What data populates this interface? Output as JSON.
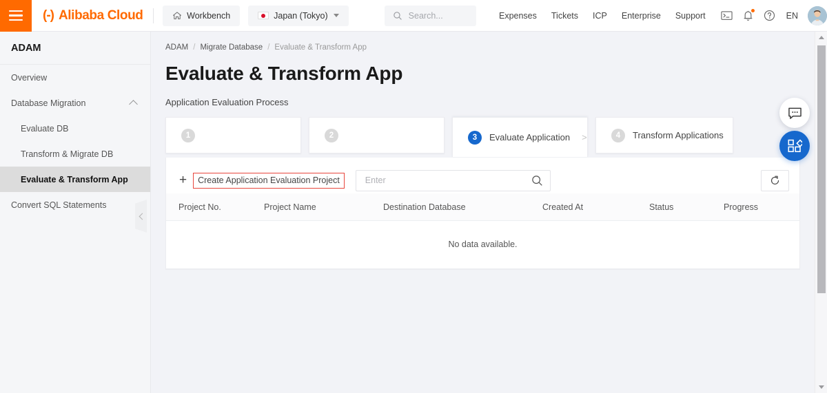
{
  "header": {
    "menu_icon": "hamburger-icon",
    "brand_mark": "(-)",
    "brand_text": "Alibaba Cloud",
    "workbench_label": "Workbench",
    "region_label": "Japan (Tokyo)",
    "search_placeholder": "Search...",
    "nav_links": [
      {
        "label": "Expenses"
      },
      {
        "label": "Tickets"
      },
      {
        "label": "ICP"
      },
      {
        "label": "Enterprise"
      },
      {
        "label": "Support"
      }
    ],
    "icons": [
      {
        "name": "terminal-icon"
      },
      {
        "name": "bell-icon",
        "badge": true
      },
      {
        "name": "help-circle-icon"
      }
    ],
    "language": "EN",
    "avatar": "user-avatar"
  },
  "sidebar": {
    "title": "ADAM",
    "items": [
      {
        "label": "Overview",
        "level": 0,
        "active": false,
        "expandable": false
      },
      {
        "label": "Database Migration",
        "level": 0,
        "active": false,
        "expandable": true
      },
      {
        "label": "Evaluate DB",
        "level": 1,
        "active": false,
        "expandable": false
      },
      {
        "label": "Transform & Migrate DB",
        "level": 1,
        "active": false,
        "expandable": false
      },
      {
        "label": "Evaluate & Transform App",
        "level": 1,
        "active": true,
        "expandable": false
      },
      {
        "label": "Convert SQL Statements",
        "level": 0,
        "active": false,
        "expandable": false
      }
    ]
  },
  "breadcrumb": [
    {
      "label": "ADAM",
      "current": false
    },
    {
      "label": "Migrate Database",
      "current": false
    },
    {
      "label": "Evaluate & Transform App",
      "current": true
    }
  ],
  "page": {
    "title": "Evaluate & Transform App",
    "subtitle": "Application Evaluation Process"
  },
  "steps": [
    {
      "num": "1",
      "label": "",
      "active": false,
      "arrow": ""
    },
    {
      "num": "2",
      "label": "",
      "active": false,
      "arrow": ""
    },
    {
      "num": "3",
      "label": "Evaluate Application",
      "active": true,
      "arrow": ">"
    },
    {
      "num": "4",
      "label": "Transform Applications",
      "active": false,
      "arrow": ""
    }
  ],
  "toolbar": {
    "create_label": "Create Application Evaluation Project",
    "plus_icon": "plus-icon",
    "search_placeholder": "Enter",
    "search_icon": "search-icon",
    "refresh_icon": "refresh-icon"
  },
  "table": {
    "columns": [
      "Project No.",
      "Project Name",
      "Destination Database",
      "Created At",
      "Status",
      "Progress"
    ],
    "rows": [],
    "empty_text": "No data available."
  },
  "floating": {
    "chat_icon": "chat-bubble-icon",
    "apps_icon": "apps-grid-icon"
  },
  "colors": {
    "brand_orange": "#ff6a00",
    "accent_blue": "#1668cd",
    "highlight_red": "#e8453c",
    "page_bg": "#f2f3f7",
    "sidebar_bg": "#f5f6f8"
  }
}
